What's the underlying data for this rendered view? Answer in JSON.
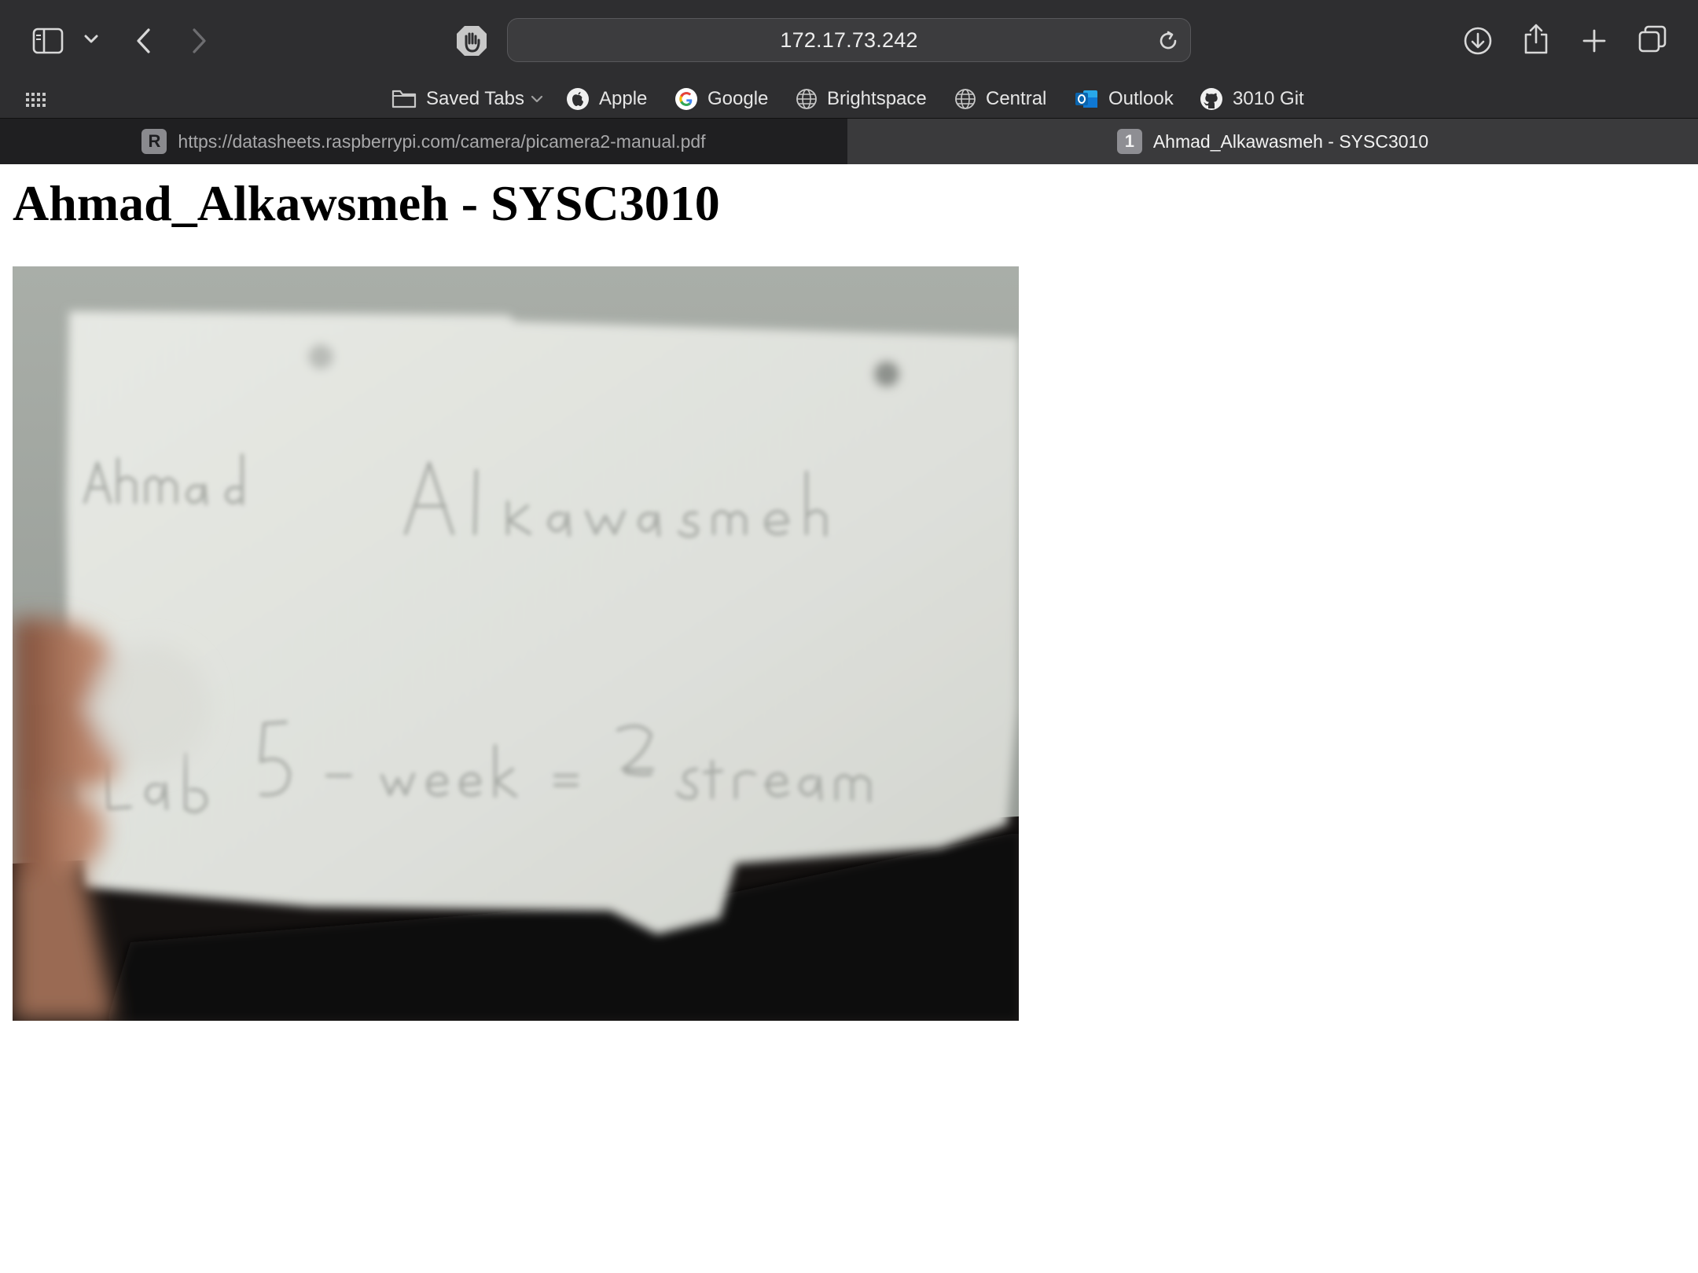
{
  "browser": {
    "url": "172.17.73.242",
    "favorites": [
      {
        "label": "Saved Tabs",
        "icon": "folder-icon"
      },
      {
        "label": "Apple",
        "icon": "apple-icon"
      },
      {
        "label": "Google",
        "icon": "google-icon"
      },
      {
        "label": "Brightspace",
        "icon": "globe-icon"
      },
      {
        "label": "Central",
        "icon": "globe-icon"
      },
      {
        "label": "Outlook",
        "icon": "outlook-icon"
      },
      {
        "label": "3010 Git",
        "icon": "github-icon"
      }
    ],
    "tabs": [
      {
        "badge": "R",
        "label": "https://datasheets.raspberrypi.com/camera/picamera2-manual.pdf",
        "active": false
      },
      {
        "badge": "1",
        "label": "Ahmad_Alkawasmeh - SYSC3010",
        "active": true
      }
    ]
  },
  "page": {
    "heading": "Ahmad_Alkawsmeh - SYSC3010",
    "image": {
      "description_icon": "camera-photo",
      "handwriting": [
        "Ahmad",
        "Alkawasmeh",
        "Lab",
        "5",
        "-",
        "week",
        "2",
        "Stream"
      ]
    }
  }
}
